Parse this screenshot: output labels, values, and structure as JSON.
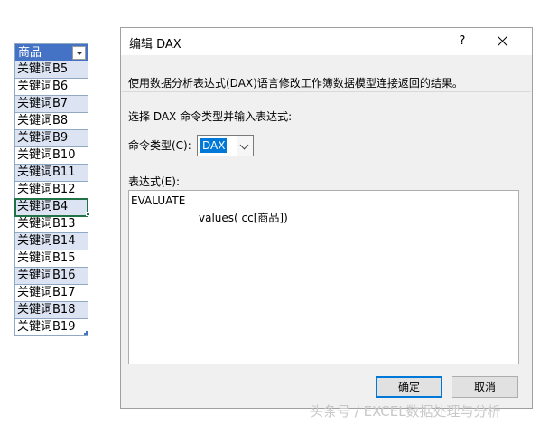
{
  "sheet": {
    "header": "商品",
    "rows": [
      "关键词B5",
      "关键词B6",
      "关键词B7",
      "关键词B8",
      "关键词B9",
      "关键词B10",
      "关键词B11",
      "关键词B12",
      "关键词B4",
      "关键词B13",
      "关键词B14",
      "关键词B15",
      "关键词B16",
      "关键词B17",
      "关键词B18",
      "关键词B19"
    ],
    "selected_index": 8,
    "colors": {
      "header_bg": "#4472c4",
      "band_bg": "#dce3f2",
      "selection": "#217346"
    }
  },
  "dialog": {
    "title": "编辑 DAX",
    "help": "?",
    "description": "使用数据分析表达式(DAX)语言修改工作簿数据模型连接返回的结果。",
    "instruction": "选择 DAX 命令类型并输入表达式:",
    "command_type_label": "命令类型(C):",
    "command_type_value": "DAX",
    "expression_label": "表达式(E):",
    "expression_line1": "EVALUATE",
    "expression_line2": "values( cc[商品])",
    "ok_label": "确定",
    "cancel_label": "取消",
    "accent_color": "#0078d7"
  },
  "watermark": "头条号 / EXCEL数据处理与分析"
}
